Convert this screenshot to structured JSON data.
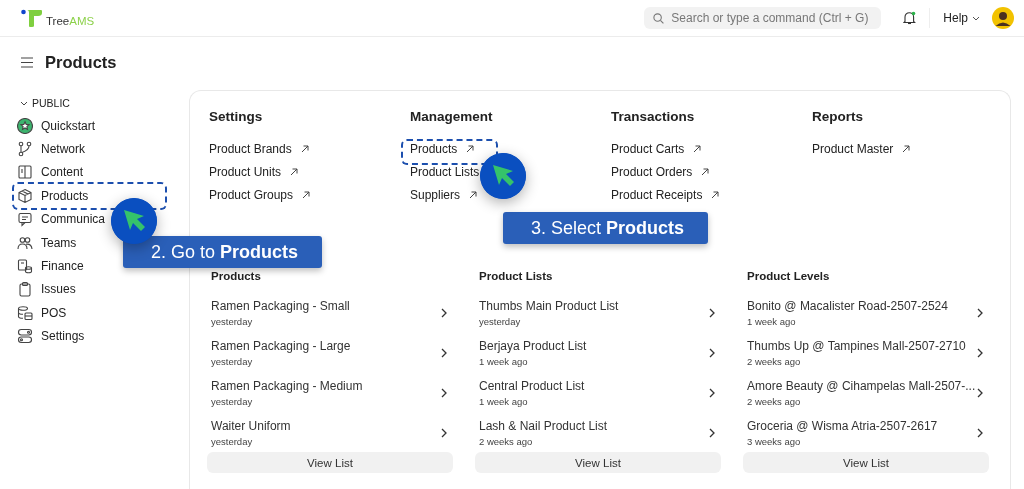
{
  "header": {
    "logo": {
      "brand": "Tree",
      "suffix": "AMS"
    },
    "search": {
      "placeholder": "Search or type a command (Ctrl + G)"
    },
    "notifications": {
      "unread": true
    },
    "help": "Help"
  },
  "page_title": "Products",
  "sidebar": {
    "section": "PUBLIC",
    "expanded": true,
    "items": [
      {
        "label": "Quickstart"
      },
      {
        "label": "Network"
      },
      {
        "label": "Content"
      },
      {
        "label": "Products"
      },
      {
        "label": "Communica"
      },
      {
        "label": "Teams"
      },
      {
        "label": "Finance"
      },
      {
        "label": "Issues"
      },
      {
        "label": "POS"
      },
      {
        "label": "Settings"
      }
    ]
  },
  "sections": [
    {
      "title": "Settings",
      "links": [
        "Product Brands",
        "Product Units",
        "Product Groups"
      ]
    },
    {
      "title": "Management",
      "links": [
        "Products",
        "Product Lists",
        "Suppliers"
      ]
    },
    {
      "title": "Transactions",
      "links": [
        "Product Carts",
        "Product Orders",
        "Product Receipts"
      ]
    },
    {
      "title": "Reports",
      "links": [
        "Product Master"
      ]
    }
  ],
  "quick_lists": [
    {
      "title": "Products",
      "button": "View List",
      "items": [
        {
          "name": "Ramen Packaging - Small",
          "time": "yesterday"
        },
        {
          "name": "Ramen Packaging - Large",
          "time": "yesterday"
        },
        {
          "name": "Ramen Packaging - Medium",
          "time": "yesterday"
        },
        {
          "name": "Waiter Uniform",
          "time": "yesterday"
        }
      ]
    },
    {
      "title": "Product Lists",
      "button": "View List",
      "items": [
        {
          "name": "Thumbs Main Product List",
          "time": "yesterday"
        },
        {
          "name": "Berjaya Product List",
          "time": "1 week ago"
        },
        {
          "name": "Central Product List",
          "time": "1 week ago"
        },
        {
          "name": "Lash & Nail Product List",
          "time": "2 weeks ago"
        }
      ]
    },
    {
      "title": "Product Levels",
      "button": "View List",
      "items": [
        {
          "name": "Bonito @ Macalister Road-2507-2524",
          "time": "1 week ago"
        },
        {
          "name": "Thumbs Up @ Tampines Mall-2507-2710",
          "time": "2 weeks ago"
        },
        {
          "name": "Amore Beauty @ Cihampelas Mall-2507-...",
          "time": "2 weeks ago"
        },
        {
          "name": "Groceria @ Wisma Atria-2507-2617",
          "time": "3 weeks ago"
        }
      ]
    }
  ],
  "callouts": [
    {
      "text": "2. Go to **Products**"
    },
    {
      "text": "3. Select **Products**"
    }
  ]
}
